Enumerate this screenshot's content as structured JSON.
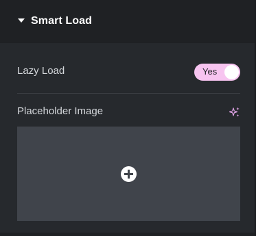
{
  "section": {
    "title": "Smart Load",
    "collapse_icon": "caret-down-icon"
  },
  "lazy_load": {
    "label": "Lazy Load",
    "toggle_text": "Yes",
    "enabled": true
  },
  "placeholder": {
    "label": "Placeholder Image",
    "ai_icon": "sparkle-icon",
    "add_icon": "plus-circle-icon"
  },
  "colors": {
    "toggle_bg": "#f7c4f0",
    "ai_icon": "#e2a5e8",
    "image_box": "#40444b",
    "panel": "#26292d",
    "header": "#1f2124"
  }
}
